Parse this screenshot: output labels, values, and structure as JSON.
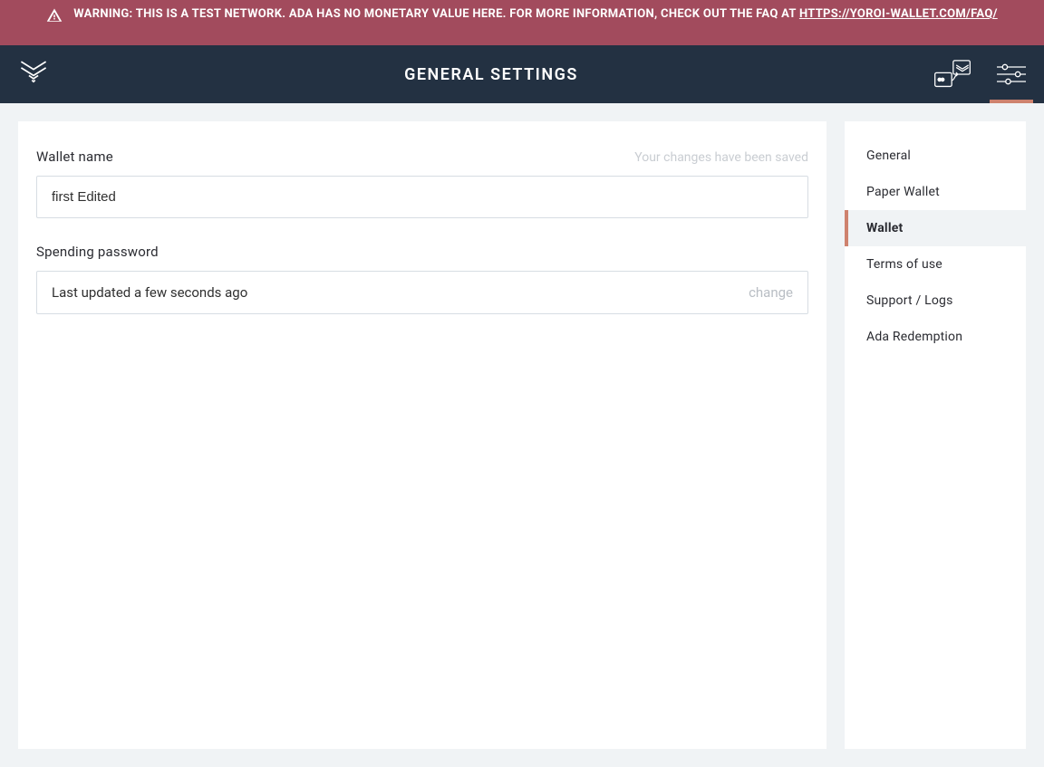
{
  "warning": {
    "text": "WARNING: THIS IS A TEST NETWORK. ADA HAS NO MONETARY VALUE HERE. FOR MORE INFORMATION, CHECK OUT THE FAQ AT ",
    "link_text": "HTTPS://YOROI-WALLET.COM/FAQ/"
  },
  "topbar": {
    "title": "GENERAL SETTINGS"
  },
  "main": {
    "wallet_name_label": "Wallet name",
    "saved_message": "Your changes have been saved",
    "wallet_name_value": "first Edited",
    "spending_password_label": "Spending password",
    "spending_password_status": "Last updated a few seconds ago",
    "change_label": "change"
  },
  "sidebar": {
    "items": [
      {
        "label": "General",
        "active": false
      },
      {
        "label": "Paper Wallet",
        "active": false
      },
      {
        "label": "Wallet",
        "active": true
      },
      {
        "label": "Terms of use",
        "active": false
      },
      {
        "label": "Support / Logs",
        "active": false
      },
      {
        "label": "Ada Redemption",
        "active": false
      }
    ]
  }
}
